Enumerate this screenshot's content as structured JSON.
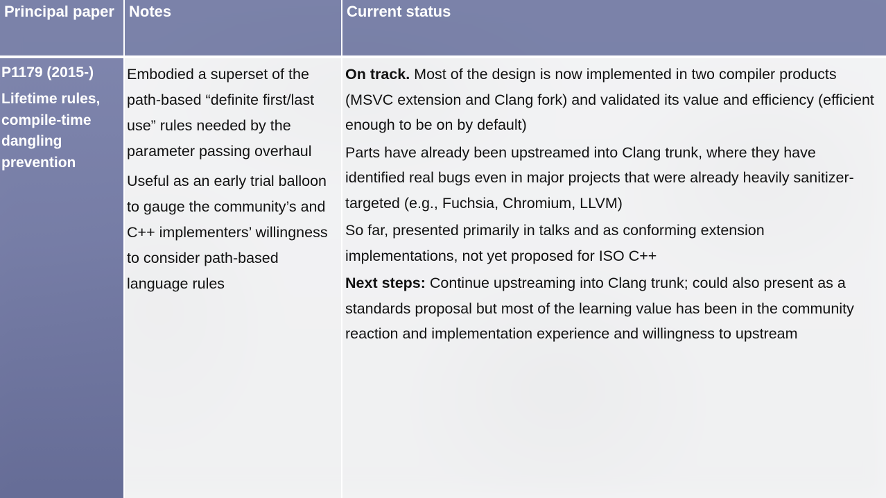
{
  "slide": {
    "kind": "status-table-slide",
    "colors": {
      "header_band": "#7077a3",
      "first_column": "#767da8",
      "body_cell": "#fcfcfd",
      "header_text": "#ffffff",
      "body_text": "#111111",
      "grid_line": "#ffffff"
    }
  },
  "table": {
    "columns": [
      {
        "key": "principal_paper",
        "header": "Principal paper"
      },
      {
        "key": "notes",
        "header": "Notes"
      },
      {
        "key": "current_status",
        "header": "Current status"
      }
    ],
    "rows": [
      {
        "principal_paper": {
          "id": "P1179 (2015-)",
          "title": "Lifetime rules, compile-time dangling prevention"
        },
        "notes": [
          "Embodied a superset of the path-based “definite first/last use” rules needed by the parameter passing overhaul",
          "Useful as an early trial balloon to gauge the community’s and C++ implementers’ willingness to consider path-based language rules"
        ],
        "current_status": [
          {
            "lead": "On track.",
            "text": " Most of the design is now implemented in two compiler products (MSVC extension and Clang fork) and validated its value and efficiency (efficient enough to be on by default)"
          },
          {
            "lead": "",
            "text": "Parts have already been upstreamed into Clang trunk, where they have identified real bugs even in major projects that were already heavily sanitizer-targeted (e.g., Fuchsia, Chromium, LLVM)"
          },
          {
            "lead": "",
            "text": "So far, presented primarily in talks and as conforming extension implementations, not yet proposed for ISO C++"
          },
          {
            "lead": "Next steps:",
            "text": " Continue upstreaming into Clang trunk; could also present as a standards proposal but most of the learning value has been in the community reaction and implementation experience and willingness to upstream"
          }
        ]
      }
    ]
  }
}
